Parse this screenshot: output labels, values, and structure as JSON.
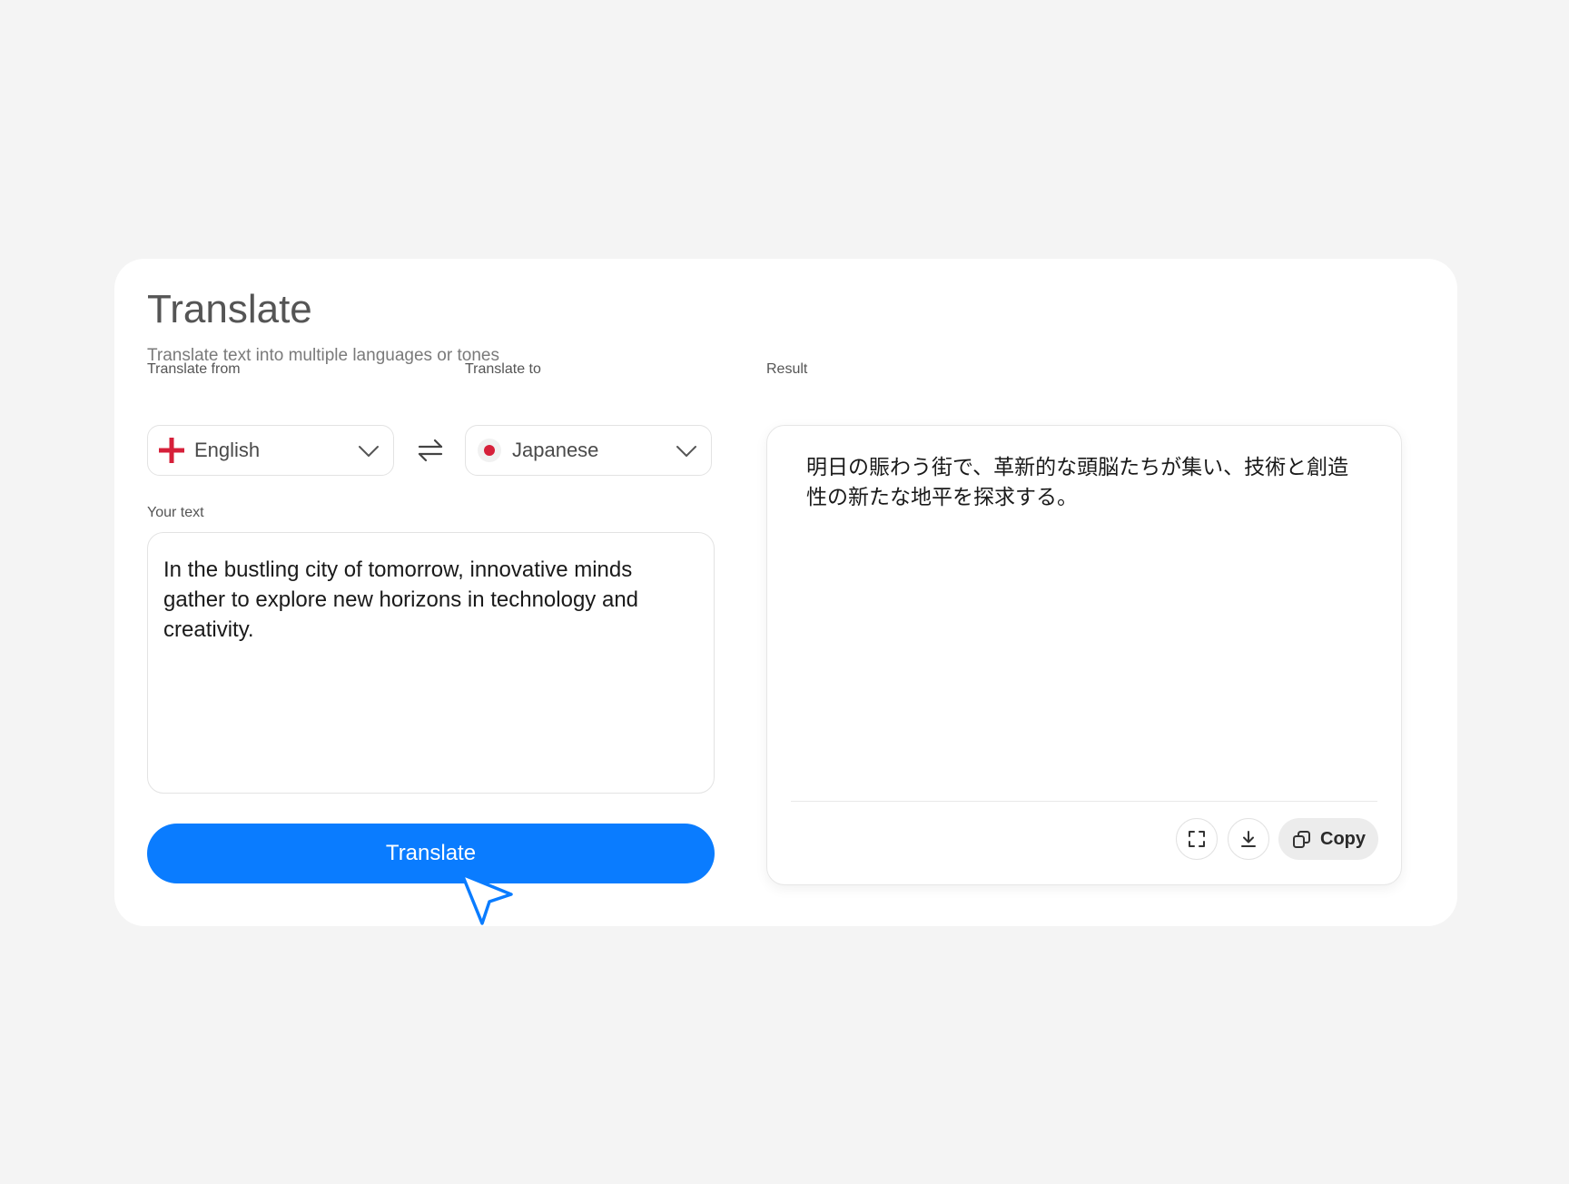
{
  "header": {
    "title": "Translate",
    "subtitle": "Translate text into multiple languages or tones"
  },
  "from": {
    "label": "Translate from",
    "language": "English",
    "flag": "england-flag-icon"
  },
  "to": {
    "label": "Translate to",
    "language": "Japanese",
    "flag": "japan-flag-icon"
  },
  "input": {
    "label": "Your text",
    "value": "In the bustling city of tomorrow, innovative minds gather to explore new horizons in technology and creativity."
  },
  "action": {
    "translate_label": "Translate"
  },
  "result": {
    "label": "Result",
    "text": "明日の賑わう街で、革新的な頭脳たちが集い、技術と創造性の新たな地平を探求する。",
    "copy_label": "Copy"
  },
  "colors": {
    "primary": "#0a7cff",
    "flag_red": "#d6203a",
    "background": "#f4f4f4",
    "card": "#ffffff"
  },
  "icons": {
    "swap": "swap-arrows-icon",
    "chevron": "chevron-down-icon",
    "expand": "expand-icon",
    "download": "download-icon",
    "copy": "copy-icon",
    "cursor": "mouse-pointer-icon"
  }
}
